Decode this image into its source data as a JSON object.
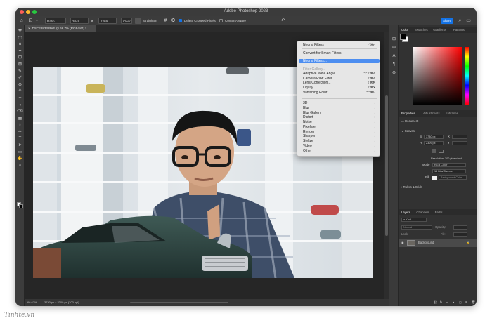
{
  "app": {
    "title": "Adobe Photoshop 2023"
  },
  "options_bar": {
    "ratio_label": "Ratio",
    "width_value": "2048",
    "swap_glyph": "⇄",
    "height_value": "1269",
    "clear_label": "Clear",
    "straighten_label": "Straighten",
    "delete_cropped_label": "Delete Cropped Pixels",
    "content_aware_label": "Content-Aware",
    "share_label": "Share"
  },
  "document": {
    "tab_label": "DSCF8833.RAF @ 66.7% (RGB/16*) *",
    "tab_close_glyph": "×",
    "zoom": "66.67%",
    "dimensions": "3730 px x 2309 px (300 ppi)"
  },
  "filter_menu": {
    "items": [
      {
        "label": "Neural Filters",
        "shortcut": "^⌘F"
      },
      {
        "label": "Convert for Smart Filters",
        "shortcut": ""
      },
      {
        "label": "Neural Filters...",
        "shortcut": ""
      },
      {
        "label": "Filter Gallery...",
        "shortcut": ""
      },
      {
        "label": "Adaptive Wide Angle...",
        "shortcut": "⌥⇧⌘A"
      },
      {
        "label": "Camera Raw Filter...",
        "shortcut": "⇧⌘A"
      },
      {
        "label": "Lens Correction...",
        "shortcut": "⇧⌘R"
      },
      {
        "label": "Liquify...",
        "shortcut": "⇧⌘X"
      },
      {
        "label": "Vanishing Point...",
        "shortcut": "⌥⌘V"
      },
      {
        "label": "3D",
        "shortcut": "›"
      },
      {
        "label": "Blur",
        "shortcut": "›"
      },
      {
        "label": "Blur Gallery",
        "shortcut": "›"
      },
      {
        "label": "Distort",
        "shortcut": "›"
      },
      {
        "label": "Noise",
        "shortcut": "›"
      },
      {
        "label": "Pixelate",
        "shortcut": "›"
      },
      {
        "label": "Render",
        "shortcut": "›"
      },
      {
        "label": "Sharpen",
        "shortcut": "›"
      },
      {
        "label": "Stylize",
        "shortcut": "›"
      },
      {
        "label": "Video",
        "shortcut": "›"
      },
      {
        "label": "Other",
        "shortcut": "›"
      }
    ]
  },
  "panels": {
    "color_tabs": [
      "Color",
      "Swatches",
      "Gradients",
      "Patterns"
    ],
    "properties_tabs": [
      "Properties",
      "Adjustments",
      "Libraries"
    ],
    "properties": {
      "document_label": "Document",
      "canvas_label": "Canvas",
      "w_label": "W",
      "w_value": "3730 px",
      "h_label": "H",
      "h_value": "2309 px",
      "x_label": "X",
      "y_label": "Y",
      "resolution": "Resolution: 300 pixels/inch",
      "mode_label": "Mode",
      "mode_value": "RGB Color",
      "depth_value": "16 Bits/Channel",
      "fill_label": "Fill",
      "fill_value": "Background Color",
      "rulers_label": "Rulers & Grids"
    },
    "layers_tabs": [
      "Layers",
      "Channels",
      "Paths"
    ],
    "layers": {
      "search_placeholder": "Kind",
      "blend_mode": "Normal",
      "opacity_label": "Opacity:",
      "lock_label": "Lock:",
      "fill_label": "Fill:",
      "layer_name": "Background"
    }
  },
  "icons": {
    "home": "⌂",
    "crop": "⊡",
    "chevron": "⌄",
    "swap": "⇄",
    "grid": "#",
    "gear": "⚙",
    "undo": "↶",
    "search": "⌕",
    "arrange": "▭",
    "eye": "◉",
    "lock": "🔒",
    "panel_icons": [
      "⊞",
      "⊕",
      "A",
      "¶",
      "⊚"
    ],
    "layer_footer": [
      "⛓",
      "fx",
      "◐",
      "◑",
      "▢",
      "⊞",
      "🗑"
    ],
    "tools": [
      "✥",
      "⬚",
      "ϕ",
      "✦",
      "⊡",
      "⊠",
      "✎",
      "✐",
      "⊛",
      "⚘",
      "✧",
      "◑",
      "⌫",
      "▦",
      "◌",
      "✑",
      "T",
      "➤",
      "▭",
      "✋",
      "⌕",
      "…"
    ]
  },
  "colors": {
    "accent": "#1473e6",
    "menu_highlight": "#4d8ef0"
  },
  "watermark": {
    "text": "Tinhte.vn"
  }
}
